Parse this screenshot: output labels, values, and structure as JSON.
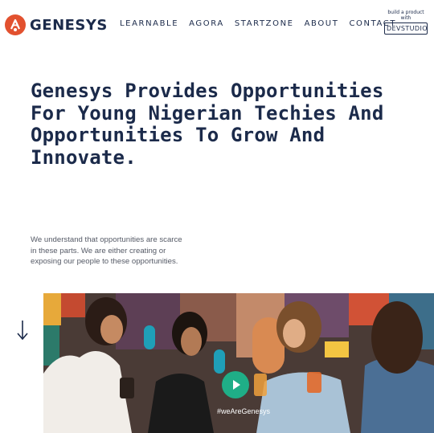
{
  "brand": {
    "name": "GENESYS"
  },
  "nav": [
    "LEARNABLE",
    "AGORA",
    "STARTZONE",
    "ABOUT",
    "CONTACT"
  ],
  "devstudio": {
    "tagline": "build a product with",
    "label": "DEVSTUDIO"
  },
  "hero": {
    "title": "Genesys Provides Opportunities For Young Nigerian Techies And Opportunities To Grow And Innovate.",
    "description": "We understand that opportunities are scarce in these parts. We are either creating or exposing our people to these opportunities."
  },
  "media": {
    "hashtag": "#weAreGenesys"
  },
  "colors": {
    "accent": "#e2512f",
    "navy": "#1b2a4a",
    "play": "#1fae87"
  },
  "icons": {
    "scroll": "arrow-down-icon",
    "play": "play-icon",
    "logo": "genesys-logo-icon"
  }
}
